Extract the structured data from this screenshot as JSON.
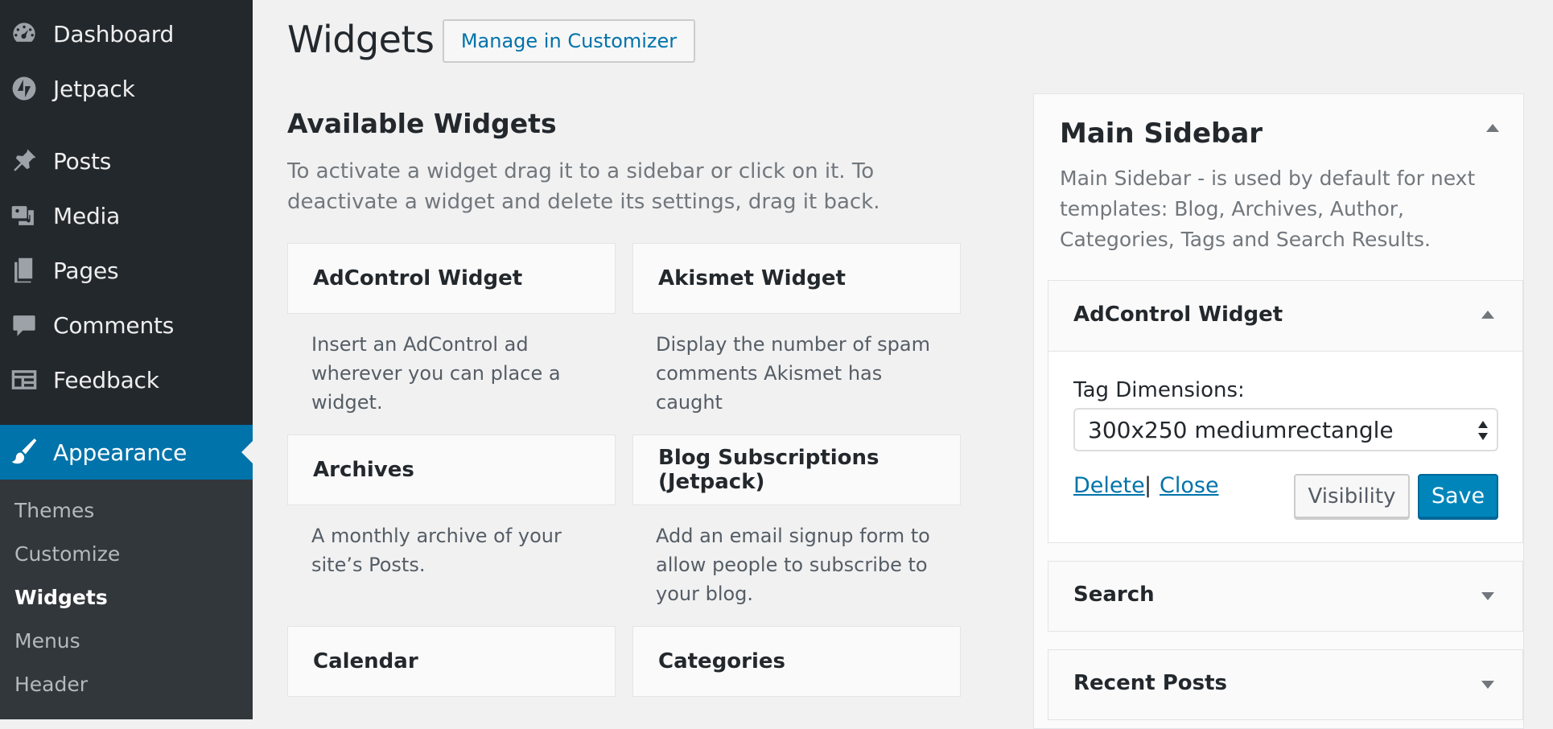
{
  "admin_menu": {
    "items": [
      {
        "label": "Dashboard",
        "icon": "dashboard-icon"
      },
      {
        "label": "Jetpack",
        "icon": "jetpack-icon"
      },
      {
        "label": "Posts",
        "icon": "pin-icon"
      },
      {
        "label": "Media",
        "icon": "media-icon"
      },
      {
        "label": "Pages",
        "icon": "pages-icon"
      },
      {
        "label": "Comments",
        "icon": "comment-icon"
      },
      {
        "label": "Feedback",
        "icon": "feedback-icon"
      },
      {
        "label": "Appearance",
        "icon": "paintbrush-icon"
      }
    ],
    "submenu": [
      {
        "label": "Themes"
      },
      {
        "label": "Customize"
      },
      {
        "label": "Widgets"
      },
      {
        "label": "Menus"
      },
      {
        "label": "Header"
      }
    ],
    "current_color": "#0073aa"
  },
  "header": {
    "title": "Widgets",
    "manage_button": "Manage in Customizer"
  },
  "available": {
    "title": "Available Widgets",
    "description": "To activate a widget drag it to a sidebar or click on it. To deactivate a widget and delete its settings, drag it back.",
    "widgets": [
      {
        "name": "AdControl Widget",
        "description": "Insert an AdControl ad wherever you can place a widget."
      },
      {
        "name": "Akismet Widget",
        "description": "Display the number of spam comments Akismet has caught"
      },
      {
        "name": "Archives",
        "description": "A monthly archive of your site’s Posts."
      },
      {
        "name": "Blog Subscriptions (Jetpack)",
        "description": "Add an email signup form to allow people to subscribe to your blog."
      },
      {
        "name": "Calendar",
        "description": ""
      },
      {
        "name": "Categories",
        "description": ""
      }
    ]
  },
  "sidebar": {
    "title": "Main Sidebar",
    "description": "Main Sidebar - is used by default for next templates: Blog, Archives, Author, Categories, Tags and Search Results.",
    "open_widget": {
      "title": "AdControl Widget",
      "tag_label": "Tag Dimensions:",
      "tag_value": "300x250 mediumrectangle",
      "delete_label": "Delete",
      "separator": "|",
      "close_label": "Close",
      "visibility_label": "Visibility",
      "save_label": "Save"
    },
    "collapsed_widgets": [
      {
        "title": "Search"
      },
      {
        "title": "Recent Posts"
      }
    ]
  }
}
